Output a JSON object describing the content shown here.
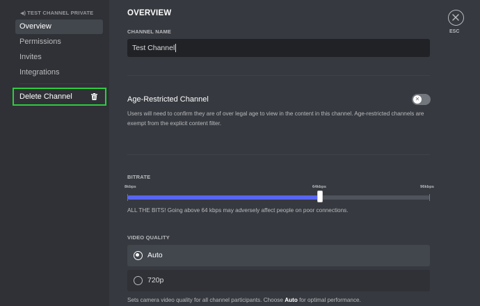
{
  "sidebar": {
    "channel_header": "TEST CHANNEL PRIVATE",
    "channel_icon": "speaker-icon",
    "items": [
      {
        "label": "Overview",
        "selected": true
      },
      {
        "label": "Permissions",
        "selected": false
      },
      {
        "label": "Invites",
        "selected": false
      },
      {
        "label": "Integrations",
        "selected": false
      }
    ],
    "delete_label": "Delete Channel",
    "delete_icon": "trash-icon",
    "highlight_color": "#2ecc40"
  },
  "main": {
    "title": "OVERVIEW",
    "channel_name": {
      "label": "CHANNEL NAME",
      "value": "Test Channel"
    },
    "age_restricted": {
      "title": "Age-Restricted Channel",
      "description": "Users will need to confirm they are of over legal age to view in the content in this channel. Age-restricted channels are exempt from the explicit content filter.",
      "enabled": false,
      "toggle_glyph": "✕"
    },
    "bitrate": {
      "label": "BITRATE",
      "ticks": [
        "8kbps",
        "64kbps",
        "96kbps"
      ],
      "min_kbps": 8,
      "max_kbps": 96,
      "value_kbps": 64,
      "note": "ALL THE BITS! Going above 64 kbps may adversely affect people on poor connections."
    },
    "video_quality": {
      "label": "VIDEO QUALITY",
      "options": [
        {
          "label": "Auto",
          "selected": true
        },
        {
          "label": "720p",
          "selected": false
        }
      ],
      "note_before": "Sets camera video quality for all channel participants. Choose ",
      "note_bold": "Auto",
      "note_after": " for optimal performance."
    }
  },
  "close": {
    "label": "ESC",
    "icon": "close-icon"
  },
  "colors": {
    "accent": "#5865f2",
    "background": "#36393f",
    "sidebar": "#2f3136"
  }
}
